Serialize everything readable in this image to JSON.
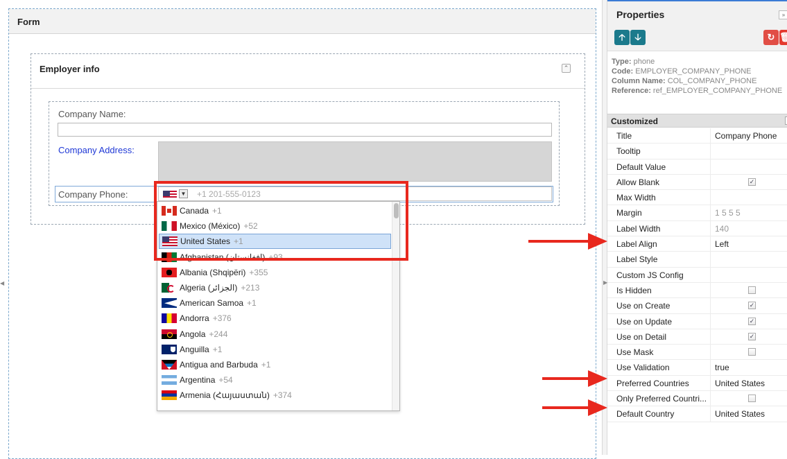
{
  "form": {
    "title": "Form"
  },
  "employer": {
    "title": "Employer info",
    "collapse_icon": "double-chevron-up-icon",
    "fields": {
      "company_name_label": "Company Name:",
      "company_name_value": "",
      "company_address_label": "Company Address:",
      "company_phone_label": "Company Phone:",
      "phone_placeholder": "+1 201-555-0123"
    }
  },
  "country_dropdown": {
    "items": [
      {
        "name": "Canada",
        "code": "+1",
        "flag": "ca"
      },
      {
        "name": "Mexico (México)",
        "code": "+52",
        "flag": "mx"
      },
      {
        "name": "United States",
        "code": "+1",
        "flag": "us",
        "selected": true
      },
      {
        "name": "Afghanistan (‫افغانستان‬‎)",
        "code": "+93",
        "flag": "af"
      },
      {
        "name": "Albania (Shqipëri)",
        "code": "+355",
        "flag": "al"
      },
      {
        "name": "Algeria (‫الجزائر‬‎)",
        "code": "+213",
        "flag": "dz"
      },
      {
        "name": "American Samoa",
        "code": "+1",
        "flag": "as"
      },
      {
        "name": "Andorra",
        "code": "+376",
        "flag": "ad"
      },
      {
        "name": "Angola",
        "code": "+244",
        "flag": "ao"
      },
      {
        "name": "Anguilla",
        "code": "+1",
        "flag": "ai"
      },
      {
        "name": "Antigua and Barbuda",
        "code": "+1",
        "flag": "ag"
      },
      {
        "name": "Argentina",
        "code": "+54",
        "flag": "ar"
      },
      {
        "name": "Armenia (Հայաստան)",
        "code": "+374",
        "flag": "am"
      }
    ]
  },
  "properties": {
    "title": "Properties",
    "toolbar": {
      "up_icon": "arrow-up-icon",
      "down_icon": "arrow-down-icon",
      "reset_icon": "reset-icon",
      "delete_icon": "trash-icon"
    },
    "meta": {
      "type_label": "Type:",
      "type_value": "phone",
      "code_label": "Code:",
      "code_value": "EMPLOYER_COMPANY_PHONE",
      "column_label": "Column Name:",
      "column_value": "COL_COMPANY_PHONE",
      "reference_label": "Reference:",
      "reference_value": "ref_EMPLOYER_COMPANY_PHONE"
    },
    "section": "Customized",
    "rows": [
      {
        "name": "Title",
        "value": "Company Phone"
      },
      {
        "name": "Tooltip",
        "value": ""
      },
      {
        "name": "Default Value",
        "value": ""
      },
      {
        "name": "Allow Blank",
        "checkbox": true,
        "checked": true
      },
      {
        "name": "Max Width",
        "value": ""
      },
      {
        "name": "Margin",
        "value": "1 5 5 5",
        "muted": true
      },
      {
        "name": "Label Width",
        "value": "140",
        "muted": true
      },
      {
        "name": "Label Align",
        "value": "Left"
      },
      {
        "name": "Label Style",
        "value": ""
      },
      {
        "name": "Custom JS Config",
        "value": ""
      },
      {
        "name": "Is Hidden",
        "checkbox": true,
        "checked": false
      },
      {
        "name": "Use on Create",
        "checkbox": true,
        "checked": true
      },
      {
        "name": "Use on Update",
        "checkbox": true,
        "checked": true
      },
      {
        "name": "Use on Detail",
        "checkbox": true,
        "checked": true
      },
      {
        "name": "Use Mask",
        "checkbox": true,
        "checked": false
      },
      {
        "name": "Use Validation",
        "value": "true"
      },
      {
        "name": "Preferred Countries",
        "value": "United States"
      },
      {
        "name": "Only Preferred Countri...",
        "checkbox": true,
        "checked": false
      },
      {
        "name": "Default Country",
        "value": "United States"
      }
    ]
  },
  "colors": {
    "accent": "#3a7bd5",
    "annotation_red": "#e8281e",
    "label_blue": "#1f38d6"
  }
}
